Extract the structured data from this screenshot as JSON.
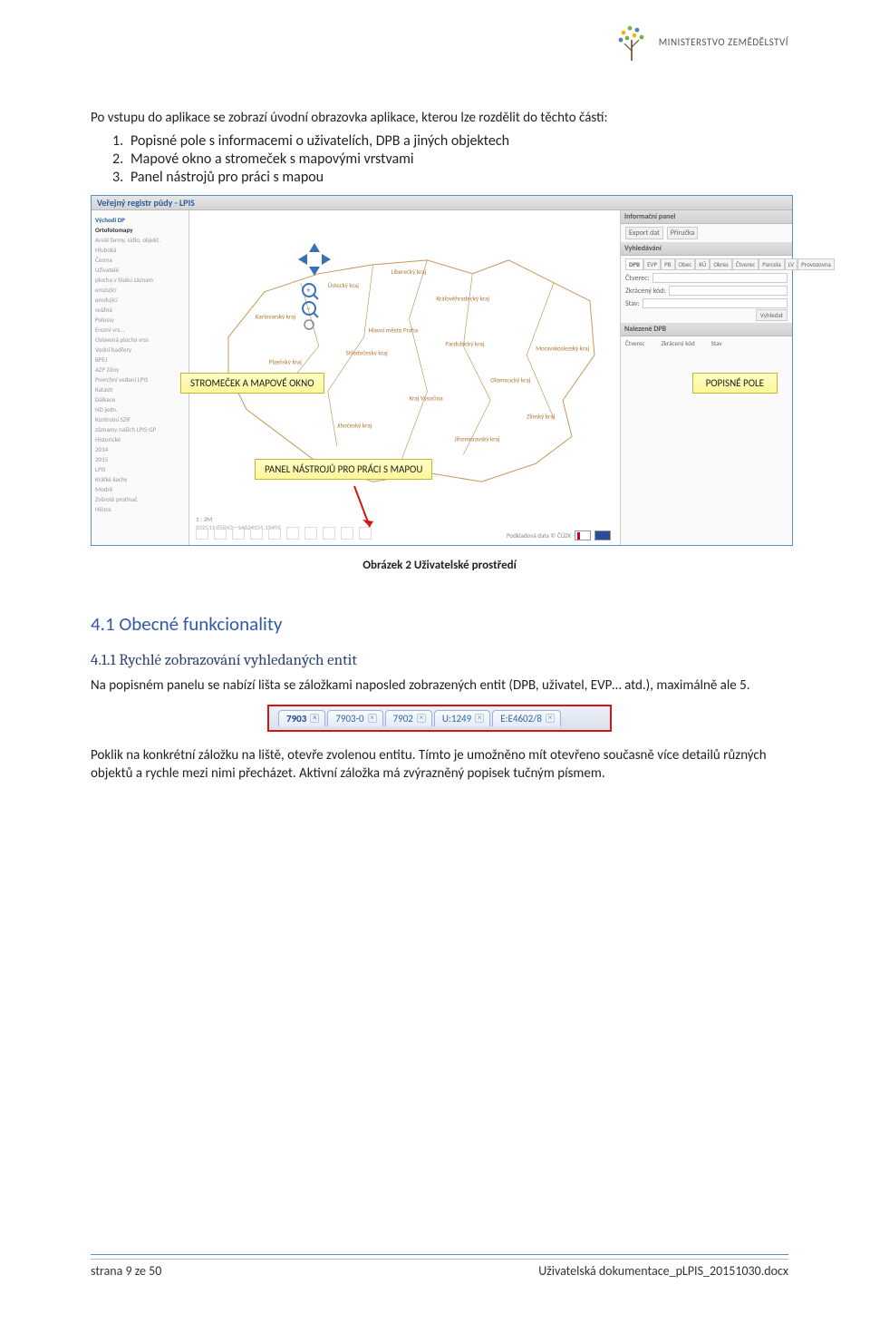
{
  "header": {
    "ministry": "MINISTERSTVO ZEMĚDĚLSTVÍ"
  },
  "intro": "Po vstupu do aplikace se zobrazí úvodní obrazovka aplikace, kterou lze rozdělit do těchto částí:",
  "parts": [
    "Popisné pole s informacemi o uživatelích, DPB a jiných objektech",
    "Mapové okno a stromeček s mapovými vrstvami",
    "Panel nástrojů pro práci s mapou"
  ],
  "screenshot": {
    "appTitle": "Veřejný registr půdy - LPIS",
    "leftTree": {
      "title": "Východí DP",
      "items": [
        "Ortofotomapy",
        "Areál farmy, sídlo, objekt.",
        "Hluboká",
        "Česma",
        "Uživatelé",
        "plocha v bloku záznam",
        "erozující",
        "erodující",
        "svážné",
        "Polossy",
        "Erozní vrs…",
        "Oslavená plocha vrss",
        "Vodní badřery",
        "BPEJ",
        "AZP Zóny",
        "Povrchní vedení LPIS",
        "Katastr",
        "Dálkace",
        "ND jedn.",
        "Kontrolní SZIF",
        "záznamy našich LPIS-GP",
        "Historické",
        "2014",
        "2015",
        "LPIS",
        "Krátké kachy",
        "Modrě",
        "Zvěroté protínač",
        "Hlínce"
      ]
    },
    "mapRegions": [
      "Ústecký kraj",
      "Liberecký kraj",
      "Karlovarský kraj",
      "Královéhradecký kraj",
      "Hlavní město Praha",
      "Středočeský kraj",
      "Pardubický kraj",
      "Plzeňský kraj",
      "Moravskoslezský kraj",
      "Olomoucký kraj",
      "Kraj Vysočina",
      "Jihočeský kraj",
      "Jihomoravský kraj",
      "Zlínský kraj"
    ],
    "rightPanel": {
      "title": "Informační panel",
      "btnExport": "Export dat",
      "btnManual": "Příručka",
      "searchHead": "Vyhledávání",
      "tabs": [
        "DPB",
        "EVP",
        "PB",
        "Obec",
        "KÚ",
        "Okres",
        "Čtverec",
        "Parcela",
        "LV",
        "Provozovna"
      ],
      "fldCtverec": "Čtverec:",
      "fldZkraceny": "Zkrácený kód:",
      "fldStav": "Stav:",
      "btnSearch": "Vyhledat",
      "listHead": "Nalezené DPB",
      "cols": [
        "Čtverec",
        "Zkrácený kód",
        "Stav"
      ]
    },
    "scale": "1 : 2M",
    "coords": "352511.85043, -14624151.10496",
    "bottomRight": "Podkladová data © ČÚZK",
    "callouts": {
      "c1": "STROMEČEK A MAPOVÉ OKNO",
      "c2": "POPISNÉ POLE",
      "c3": "PANEL NÁSTROJŮ PRO PRÁCI S MAPOU"
    }
  },
  "caption": "Obrázek 2 Uživatelské prostředí",
  "h2": "4.1  Obecné funkcionality",
  "h3": "4.1.1   Rychlé zobrazování vyhledaných entit",
  "para1": "Na popisném panelu se nabízí lišta se záložkami naposled zobrazených entit (DPB, uživatel, EVP… atd.), maximálně ale 5.",
  "tabs": [
    {
      "label": "7903",
      "active": true
    },
    {
      "label": "7903-0",
      "active": false
    },
    {
      "label": "7902",
      "active": false
    },
    {
      "label": "U:1249",
      "active": false
    },
    {
      "label": "E:E4602/8",
      "active": false
    }
  ],
  "para2": "Poklik na konkrétní záložku na liště, otevře zvolenou entitu. Tímto je umožněno mít otevřeno současně více detailů různých objektů a rychle mezi nimi přecházet. Aktivní záložka má zvýrazněný popisek tučným písmem.",
  "footer": {
    "left": "strana 9 ze 50",
    "right": "Uživatelská dokumentace_pLPIS_20151030.docx"
  }
}
